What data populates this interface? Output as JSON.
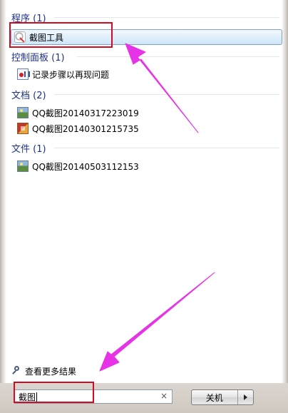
{
  "groups": [
    {
      "header": "程序 (1)",
      "items": [
        {
          "label": "截图工具",
          "icon": "snipping-tool-icon"
        }
      ]
    },
    {
      "header": "控制面板 (1)",
      "items": [
        {
          "label": "记录步骤以再现问题",
          "icon": "steps-recorder-icon"
        }
      ]
    },
    {
      "header": "文档 (2)",
      "items": [
        {
          "label": "QQ截图20140317223019",
          "icon": "image-file-icon"
        },
        {
          "label": "QQ截图20140301215735",
          "icon": "image-file-icon-alt"
        }
      ]
    },
    {
      "header": "文件 (1)",
      "items": [
        {
          "label": "QQ截图20140503112153",
          "icon": "image-file-icon"
        }
      ]
    }
  ],
  "see_more": "查看更多结果",
  "search": {
    "value": "截图"
  },
  "shutdown": {
    "label": "关机"
  },
  "colors": {
    "group_header": "#1e3287",
    "annotation_box": "#d40a1e",
    "annotation_arrow": "#e733e6"
  }
}
